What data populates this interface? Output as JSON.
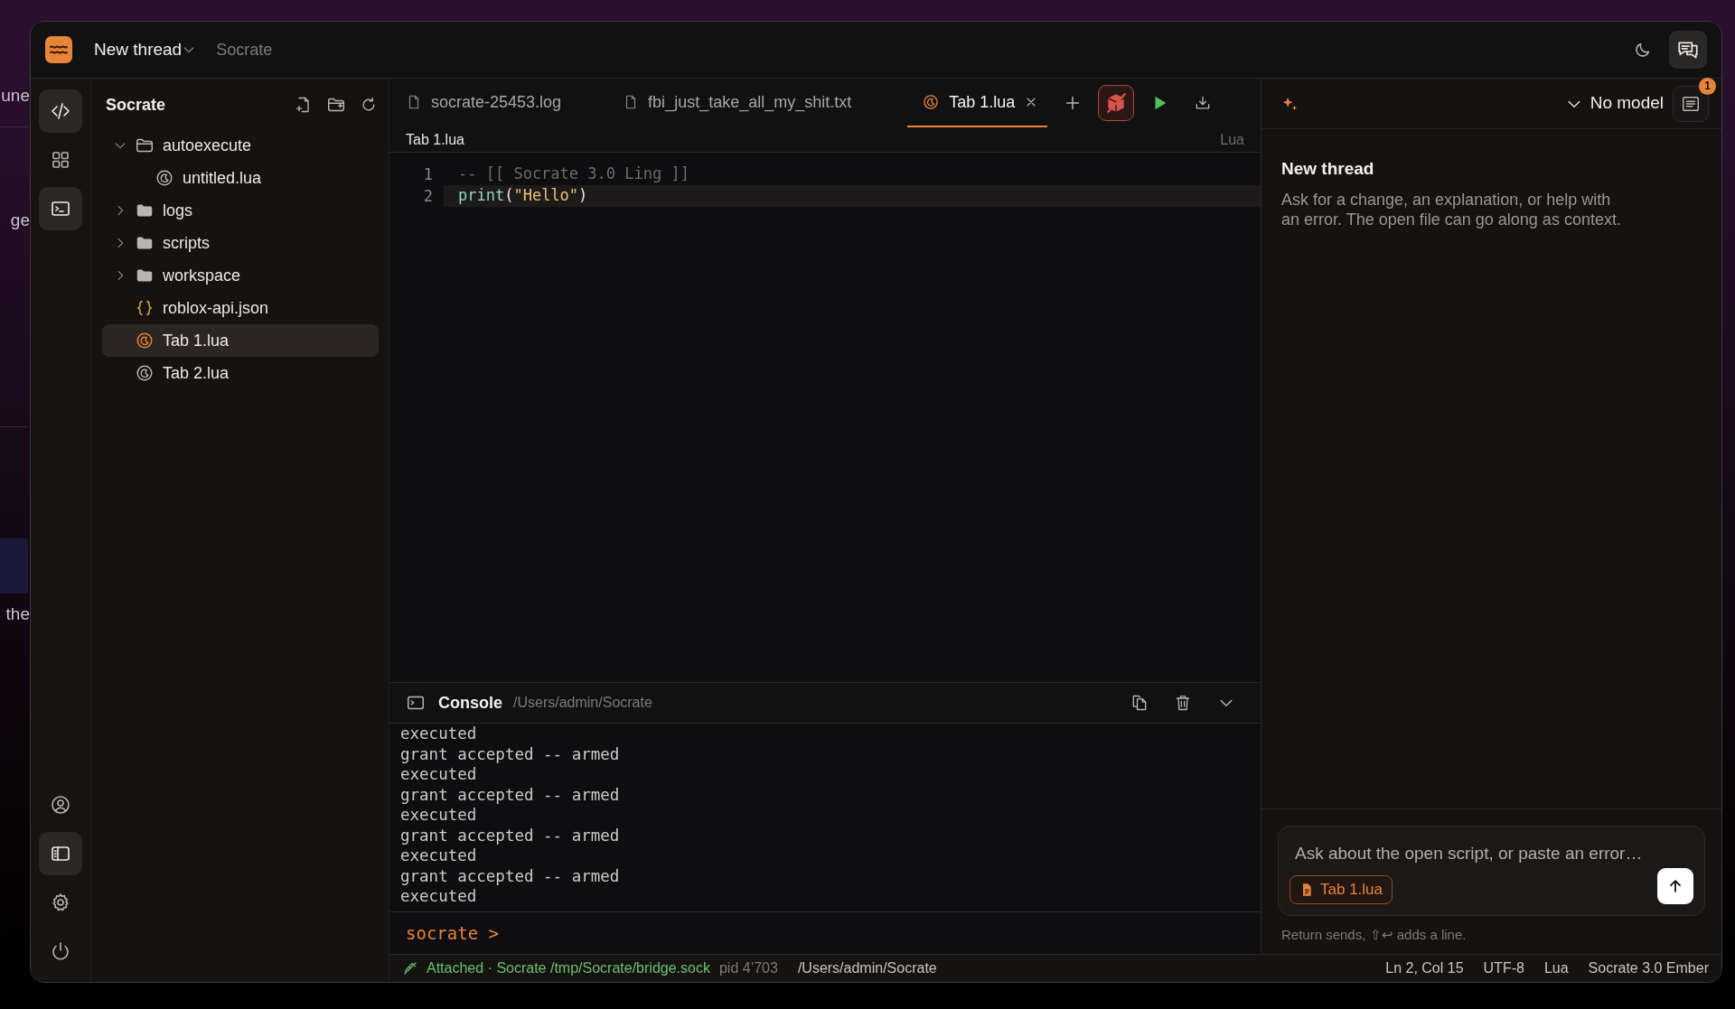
{
  "backdrop": {
    "fragments": [
      "une",
      "ge",
      "the"
    ]
  },
  "titlebar": {
    "thread_title": "New thread",
    "app_name": "Socrate"
  },
  "rail": {
    "top": [
      {
        "kind": "code",
        "selected": true
      },
      {
        "kind": "grid",
        "selected": false
      },
      {
        "kind": "terminal",
        "selected": true
      }
    ],
    "bottom": [
      {
        "kind": "account",
        "selected": false
      },
      {
        "kind": "sidebar",
        "selected": true
      },
      {
        "kind": "settings",
        "selected": false
      },
      {
        "kind": "power",
        "selected": false
      }
    ]
  },
  "explorer": {
    "title": "Socrate",
    "tree": [
      {
        "name": "autoexecute",
        "kind": "folder",
        "expanded": true,
        "selected": false,
        "children": [
          {
            "name": "untitled.lua",
            "kind": "lua",
            "selected": false
          }
        ]
      },
      {
        "name": "logs",
        "kind": "folder",
        "expanded": false,
        "selected": false
      },
      {
        "name": "scripts",
        "kind": "folder",
        "expanded": false,
        "selected": false
      },
      {
        "name": "workspace",
        "kind": "folder",
        "expanded": false,
        "selected": false
      },
      {
        "name": "roblox-api.json",
        "kind": "json",
        "selected": false
      },
      {
        "name": "Tab 1.lua",
        "kind": "lua",
        "selected": true
      },
      {
        "name": "Tab 2.lua",
        "kind": "lua",
        "selected": false
      }
    ]
  },
  "tabs": [
    {
      "label": "socrate-25453.log",
      "kind": "file",
      "selected": false
    },
    {
      "label": "fbi_just_take_all_my_shit.txt",
      "kind": "file",
      "selected": false
    },
    {
      "label": "Tab 1.lua",
      "kind": "lua",
      "selected": true
    }
  ],
  "editor": {
    "breadcrumb": "Tab 1.lua",
    "language": "Lua",
    "lines": [
      {
        "number": "1",
        "current": false,
        "tokens": [
          {
            "text": "-- [[ Socrate 3.0 Ling ]]",
            "kind": "comment"
          }
        ]
      },
      {
        "number": "2",
        "current": true,
        "tokens": [
          {
            "text": "print",
            "kind": "function"
          },
          {
            "text": "(",
            "kind": "punct"
          },
          {
            "text": "\"Hello\"",
            "kind": "string"
          },
          {
            "text": ")",
            "kind": "punct"
          }
        ]
      }
    ]
  },
  "console": {
    "title": "Console",
    "path": "/Users/admin/Socrate",
    "lines": [
      "executed",
      "grant accepted -- armed",
      "executed",
      "grant accepted -- armed",
      "executed",
      "grant accepted -- armed",
      "executed",
      "grant accepted -- armed",
      "executed"
    ],
    "prompt": "socrate >"
  },
  "chat": {
    "model": "No model",
    "notification_count": "1",
    "heading": "New thread",
    "description": "Ask for a change, an explanation, or help with an error. The open file can go along as context.",
    "input": {
      "placeholder": "Ask about the open script, or paste an error…"
    },
    "attachment": "Tab 1.lua",
    "hint": "Return sends, ⇧↩ adds a line."
  },
  "status_bar": {
    "connection": "Attached · Socrate /tmp/Socrate/bridge.sock",
    "pid": "pid 4’703",
    "cwd": "/Users/admin/Socrate",
    "position": "Ln 2, Col 15",
    "encoding": "UTF-8",
    "language": "Lua",
    "version": "Socrate 3.0 Ember"
  }
}
